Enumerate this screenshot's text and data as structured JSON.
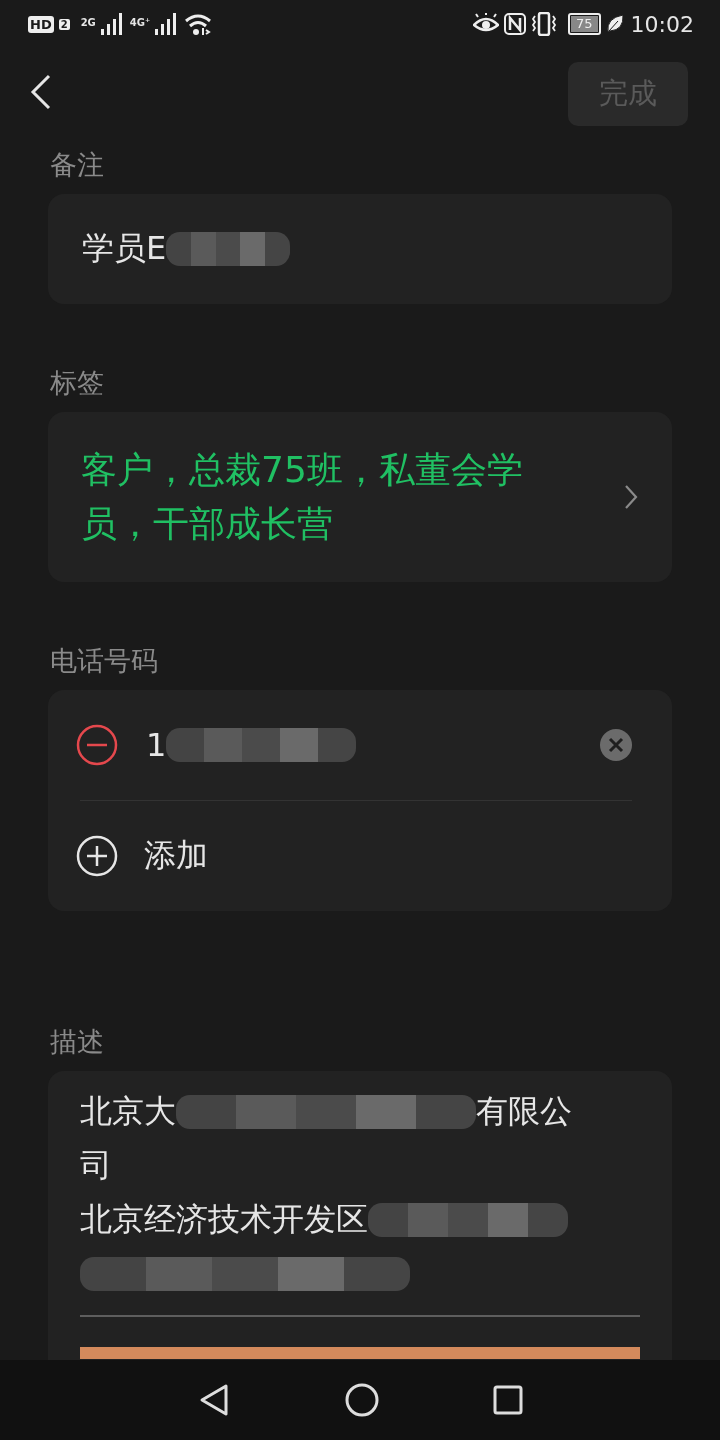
{
  "status_bar": {
    "hd": "HD",
    "sim": "2",
    "network_1": "2G",
    "network_2": "4G⁺",
    "battery": "75",
    "time": "10:02"
  },
  "header": {
    "done_button": {
      "label": "完成",
      "disabled": true
    }
  },
  "note": {
    "label": "备注",
    "segments": [
      {
        "kind": "text",
        "text": "学员E"
      },
      {
        "kind": "redacted"
      }
    ]
  },
  "tags": {
    "label": "标签",
    "value": "客户，总裁75班，私董会学员，干部成长营"
  },
  "phone": {
    "label": "电话号码",
    "numbers": [
      {
        "segments": [
          {
            "kind": "text",
            "text": "1"
          },
          {
            "kind": "redacted"
          }
        ]
      }
    ],
    "add_label": "添加"
  },
  "description": {
    "label": "描述",
    "lines": [
      {
        "segments": [
          {
            "kind": "text",
            "text": "北京大"
          },
          {
            "kind": "redacted"
          },
          {
            "kind": "text",
            "text": "有限公"
          }
        ]
      },
      {
        "segments": [
          {
            "kind": "text",
            "text": "司"
          }
        ]
      },
      {
        "segments": [
          {
            "kind": "text",
            "text": "北京经济技术开发区"
          },
          {
            "kind": "redacted"
          }
        ]
      },
      {
        "segments": [
          {
            "kind": "redacted"
          }
        ]
      }
    ]
  }
}
